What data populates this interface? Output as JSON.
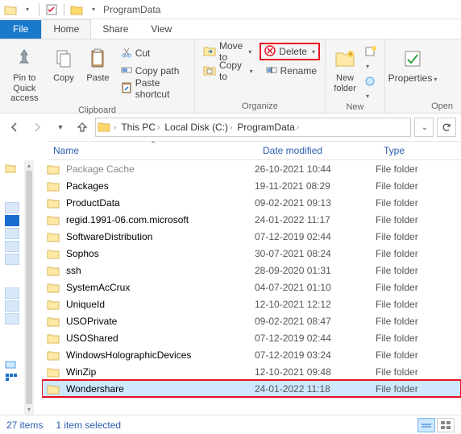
{
  "titlebar": {
    "title": "ProgramData"
  },
  "tabs": {
    "file": "File",
    "home": "Home",
    "share": "Share",
    "view": "View"
  },
  "ribbon": {
    "pin": "Pin to Quick\naccess",
    "copy": "Copy",
    "paste": "Paste",
    "cut": "Cut",
    "copypath": "Copy path",
    "pasteshortcut": "Paste shortcut",
    "clipboard_group": "Clipboard",
    "moveto": "Move to",
    "copyto": "Copy to",
    "delete": "Delete",
    "rename": "Rename",
    "organize_group": "Organize",
    "newfolder": "New\nfolder",
    "new_group": "New",
    "properties": "Properties",
    "open_group": "Open"
  },
  "breadcrumbs": [
    "This PC",
    "Local Disk (C:)",
    "ProgramData"
  ],
  "columns": {
    "name": "Name",
    "date": "Date modified",
    "type": "Type"
  },
  "items": [
    {
      "name": "Package Cache",
      "date": "26-10-2021 10:44",
      "type": "File folder",
      "dim": true
    },
    {
      "name": "Packages",
      "date": "19-11-2021 08:29",
      "type": "File folder"
    },
    {
      "name": "ProductData",
      "date": "09-02-2021 09:13",
      "type": "File folder"
    },
    {
      "name": "regid.1991-06.com.microsoft",
      "date": "24-01-2022 11:17",
      "type": "File folder"
    },
    {
      "name": "SoftwareDistribution",
      "date": "07-12-2019 02:44",
      "type": "File folder"
    },
    {
      "name": "Sophos",
      "date": "30-07-2021 08:24",
      "type": "File folder"
    },
    {
      "name": "ssh",
      "date": "28-09-2020 01:31",
      "type": "File folder"
    },
    {
      "name": "SystemAcCrux",
      "date": "04-07-2021 01:10",
      "type": "File folder"
    },
    {
      "name": "UniqueId",
      "date": "12-10-2021 12:12",
      "type": "File folder"
    },
    {
      "name": "USOPrivate",
      "date": "09-02-2021 08:47",
      "type": "File folder"
    },
    {
      "name": "USOShared",
      "date": "07-12-2019 02:44",
      "type": "File folder"
    },
    {
      "name": "WindowsHolographicDevices",
      "date": "07-12-2019 03:24",
      "type": "File folder"
    },
    {
      "name": "WinZip",
      "date": "12-10-2021 09:48",
      "type": "File folder"
    },
    {
      "name": "Wondershare",
      "date": "24-01-2022 11:18",
      "type": "File folder",
      "selected": true,
      "highlight": true
    }
  ],
  "status": {
    "count": "27 items",
    "selection": "1 item selected"
  }
}
